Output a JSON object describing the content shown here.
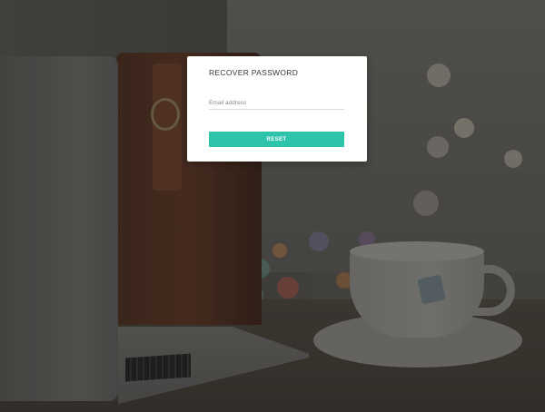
{
  "recover_form": {
    "title": "RECOVER PASSWORD",
    "email_placeholder": "Email address",
    "email_value": "",
    "reset_label": "RESET"
  },
  "colors": {
    "accent": "#2ec4ac",
    "card_background": "#ffffff",
    "title_text": "#333840"
  },
  "background": {
    "description_icons": [
      "laptop",
      "leather-bag",
      "coffee-cup"
    ]
  }
}
